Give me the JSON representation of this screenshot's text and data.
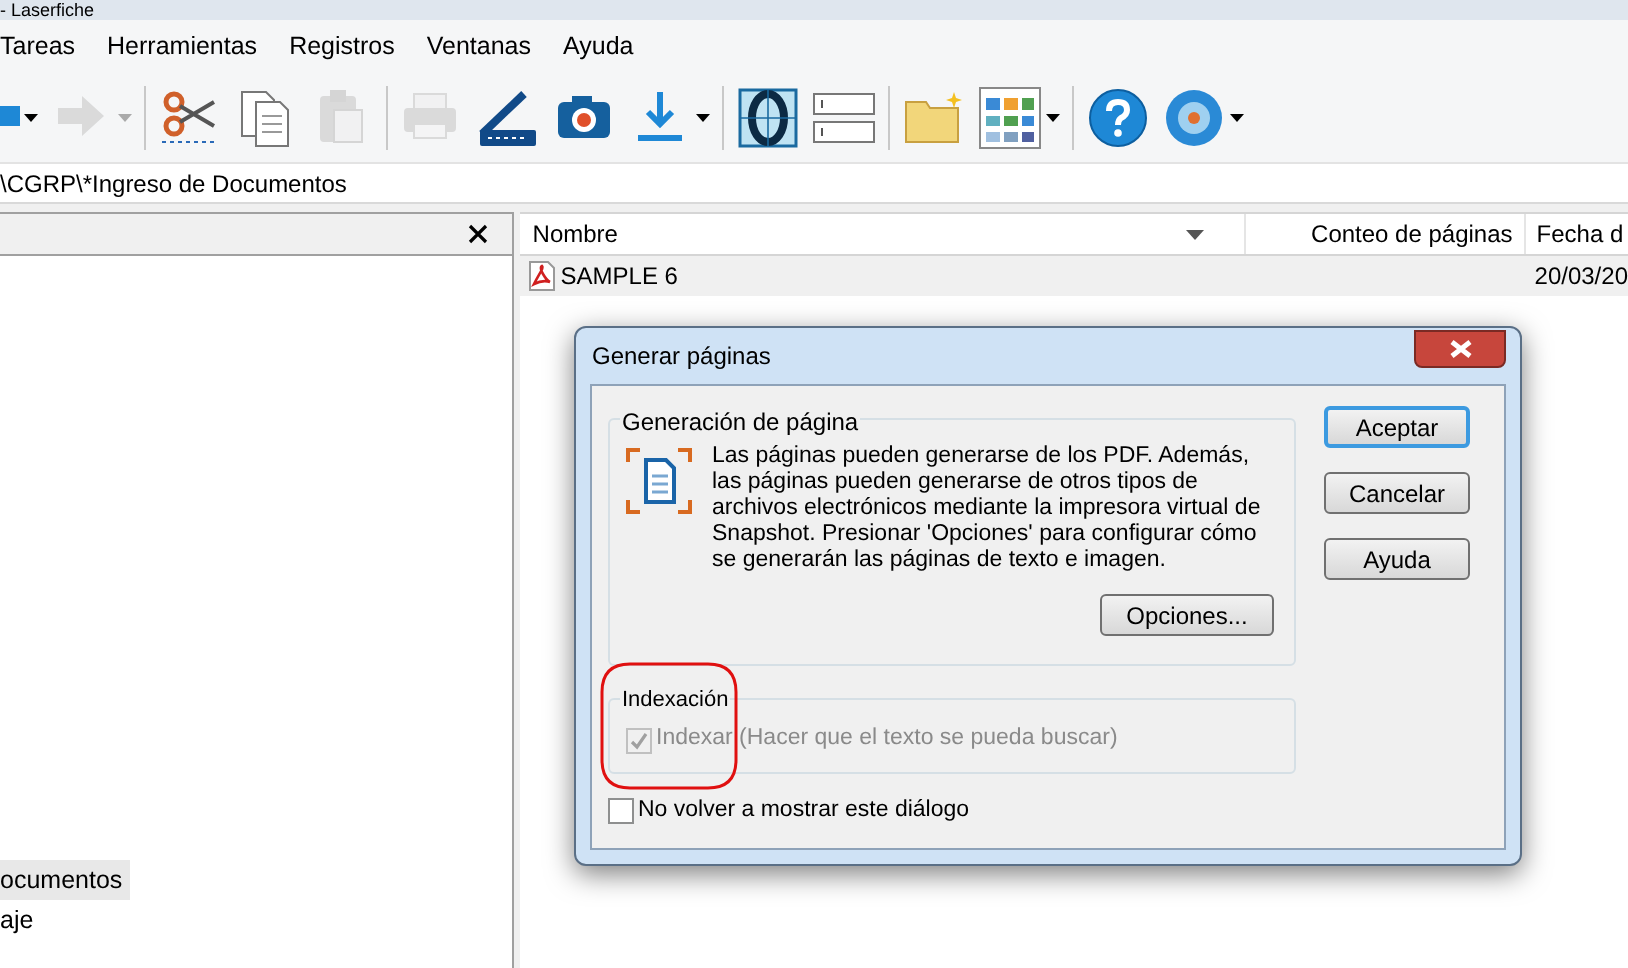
{
  "window": {
    "title": "- Laserfiche"
  },
  "menu": [
    "Tareas",
    "Herramientas",
    "Registros",
    "Ventanas",
    "Ayuda"
  ],
  "toolbar": [
    {
      "kind": "back",
      "disabled": false,
      "dropdown": true
    },
    {
      "kind": "forward",
      "disabled": true,
      "dropdown": true
    },
    {
      "kind": "sep"
    },
    {
      "kind": "cut",
      "disabled": false
    },
    {
      "kind": "copy",
      "disabled": false
    },
    {
      "kind": "paste",
      "disabled": true
    },
    {
      "kind": "sep"
    },
    {
      "kind": "print",
      "disabled": true
    },
    {
      "kind": "scanner",
      "disabled": false
    },
    {
      "kind": "camera",
      "disabled": false
    },
    {
      "kind": "download",
      "disabled": false,
      "dropdown": true
    },
    {
      "kind": "sep"
    },
    {
      "kind": "ocr",
      "disabled": false
    },
    {
      "kind": "fields",
      "disabled": false
    },
    {
      "kind": "sep"
    },
    {
      "kind": "folder",
      "disabled": false
    },
    {
      "kind": "grid",
      "disabled": false,
      "dropdown": true
    },
    {
      "kind": "sep"
    },
    {
      "kind": "help",
      "disabled": false
    },
    {
      "kind": "disc",
      "disabled": false,
      "dropdown": true
    }
  ],
  "path": "\\CGRP\\*Ingreso de Documentos",
  "tree": {
    "items": [
      {
        "label": "ocumentos",
        "selected": true
      },
      {
        "label": "aje",
        "selected": false
      }
    ]
  },
  "table": {
    "columns": [
      "Nombre",
      "Conteo de páginas",
      "Fecha d"
    ],
    "rows": [
      {
        "name": "SAMPLE 6",
        "pages": "",
        "date": "20/03/20"
      }
    ]
  },
  "dialog": {
    "title": "Generar páginas",
    "group_title": "Generación de página",
    "description": "Las páginas pueden generarse de los PDF. Además, las páginas pueden generarse de otros tipos de archivos electrónicos mediante la impresora virtual de Snapshot. Presionar 'Opciones' para configurar cómo se generarán las páginas de texto e imagen.",
    "options_button": "Opciones...",
    "index_group_title": "Indexación",
    "index_checkbox": {
      "label": "Indexar (Hacer que el texto se pueda buscar)",
      "checked": true,
      "disabled": true
    },
    "dont_show_checkbox": {
      "label": "No volver a mostrar este diálogo",
      "checked": false,
      "disabled": false
    },
    "buttons": [
      {
        "label": "Aceptar",
        "default": true
      },
      {
        "label": "Cancelar",
        "default": false
      },
      {
        "label": "Ayuda",
        "default": false
      }
    ],
    "annotation": true
  }
}
